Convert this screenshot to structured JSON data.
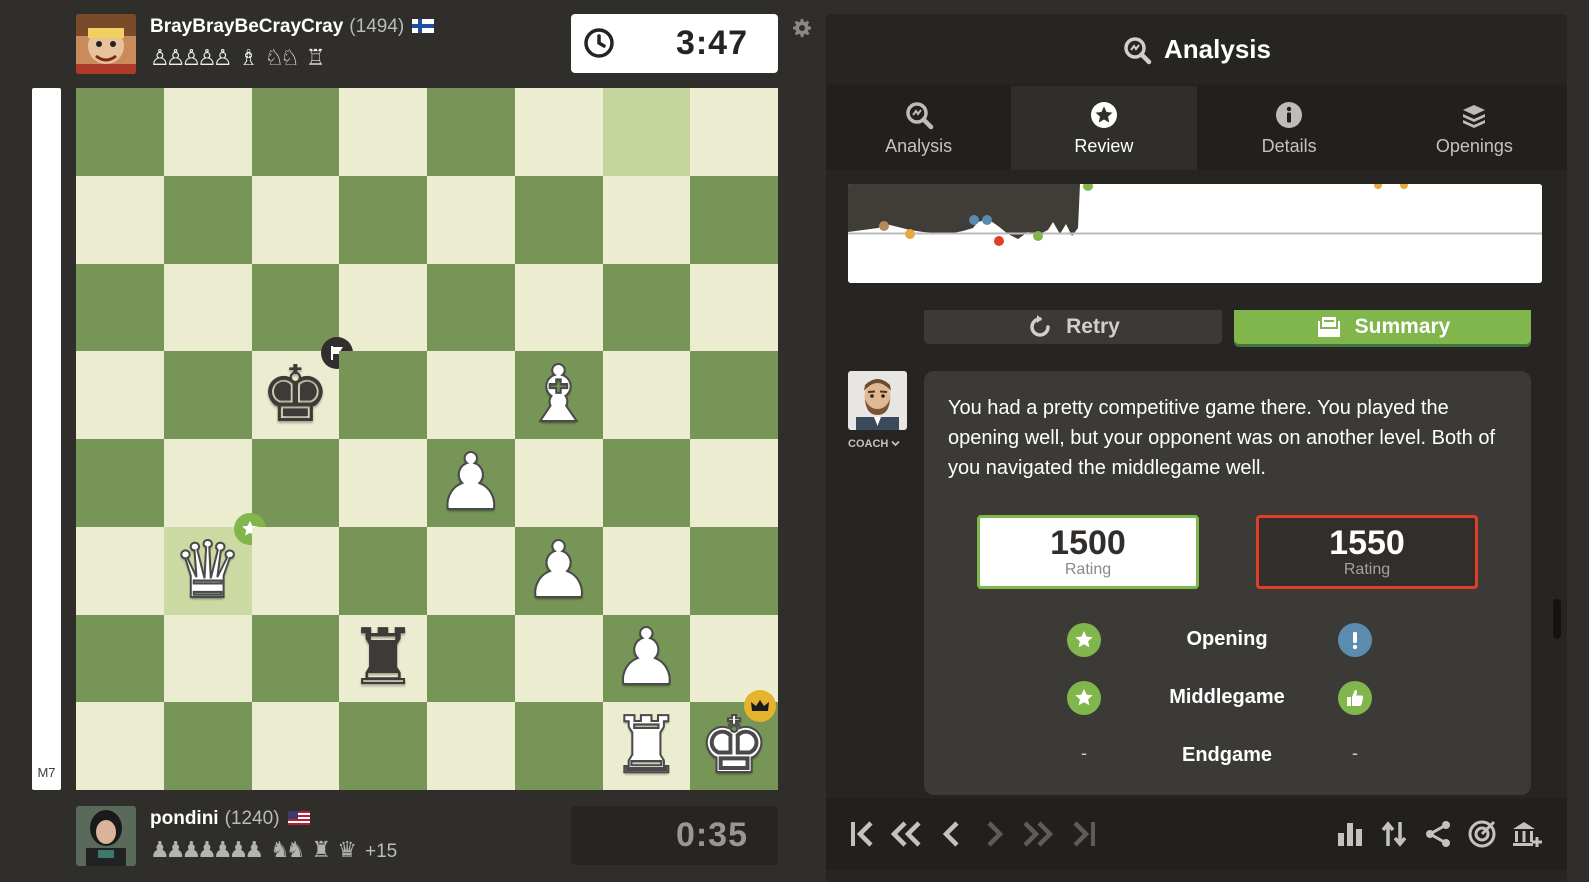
{
  "top_player": {
    "name": "BrayBrayBeCrayCray",
    "rating": "(1494)",
    "flag": "Finland",
    "captured_pawns": "♙♙♙♙♙",
    "captured_minor": "♗",
    "captured_knights": "♘♘",
    "captured_rook": "♖"
  },
  "bottom_player": {
    "name": "pondini",
    "rating": "(1240)",
    "flag": "United States",
    "captured_pawns": "♟♟♟♟♟♟♟",
    "captured_knights": "♞♞",
    "captured_rooks": "♜",
    "captured_queen": "♛",
    "material_advantage": "+15"
  },
  "clocks": {
    "top": "3:47",
    "bottom": "0:35"
  },
  "eval_bar": {
    "label": "M7",
    "white_fraction": 1.0
  },
  "board": {
    "light_color": "#ebecd0",
    "dark_color": "#779556",
    "highlight_from": "g8",
    "highlight_to": "b3",
    "pieces": [
      {
        "square": "c5",
        "glyph": "♚",
        "color": "black",
        "badge": "flag"
      },
      {
        "square": "f5",
        "glyph": "♝",
        "color": "white"
      },
      {
        "square": "e4",
        "glyph": "♟",
        "color": "white"
      },
      {
        "square": "b3",
        "glyph": "♛",
        "color": "white",
        "badge": "star"
      },
      {
        "square": "f3",
        "glyph": "♟",
        "color": "white"
      },
      {
        "square": "d2",
        "glyph": "♜",
        "color": "black"
      },
      {
        "square": "g2",
        "glyph": "♟",
        "color": "white"
      },
      {
        "square": "g1",
        "glyph": "♜",
        "color": "white"
      },
      {
        "square": "h1",
        "glyph": "♚",
        "color": "white",
        "badge": "crown"
      }
    ]
  },
  "panel": {
    "title": "Analysis",
    "tabs": [
      {
        "label": "Analysis",
        "icon": "magnifier-icon",
        "active": false
      },
      {
        "label": "Review",
        "icon": "star-icon",
        "active": true
      },
      {
        "label": "Details",
        "icon": "info-icon",
        "active": false
      },
      {
        "label": "Openings",
        "icon": "book-icon",
        "active": false
      }
    ],
    "retry_label": "Retry",
    "summary_label": "Summary",
    "coach_label": "COACH",
    "coach_text": "You had a pretty competitive game there. You played the opening well, but your opponent was on another level. Both of you navigated the middlegame well.",
    "ratings": {
      "white": {
        "value": "1500",
        "label": "Rating"
      },
      "black": {
        "value": "1550",
        "label": "Rating"
      }
    },
    "phases": [
      {
        "name": "Opening",
        "white": "best-star-icon",
        "black": "exclamation-icon"
      },
      {
        "name": "Middlegame",
        "white": "best-star-icon",
        "black": "thumbs-up-icon"
      },
      {
        "name": "Endgame",
        "white": "-",
        "black": "-"
      }
    ]
  },
  "colors": {
    "accent_green": "#81b64c",
    "accent_red": "#e23d28",
    "info_blue": "#5c8bb0"
  }
}
